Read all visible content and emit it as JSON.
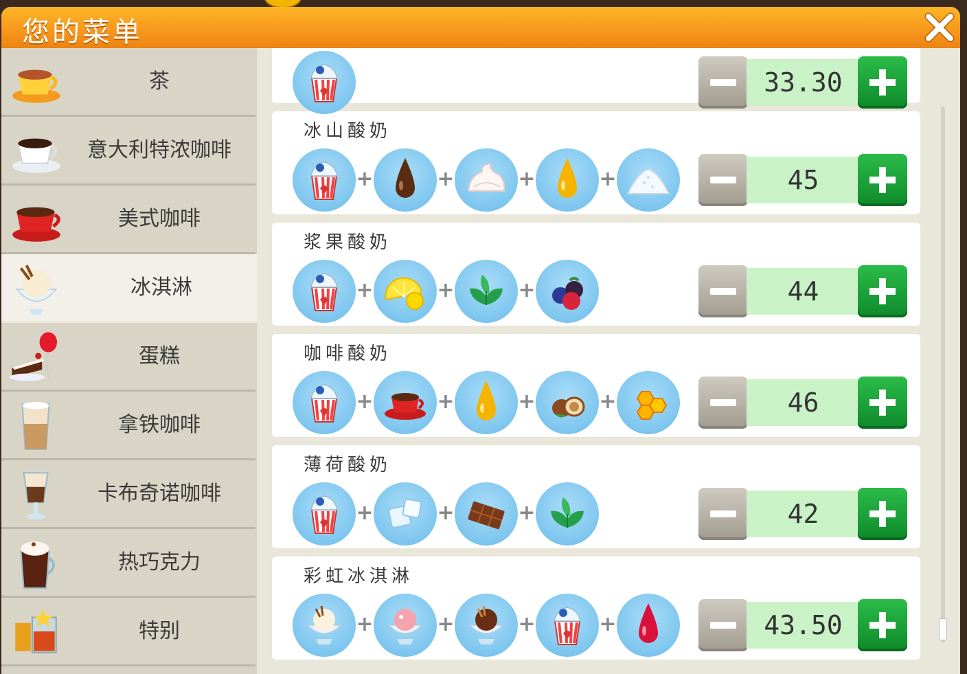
{
  "window": {
    "title": "您的菜单",
    "close_icon": "close-icon"
  },
  "categories": [
    {
      "label": "茶",
      "icon": "tea-cup-icon",
      "active": false
    },
    {
      "label": "意大利特浓咖啡",
      "icon": "espresso-cup-icon",
      "active": false
    },
    {
      "label": "美式咖啡",
      "icon": "americano-cup-icon",
      "active": false
    },
    {
      "label": "冰淇淋",
      "icon": "ice-cream-sundae-icon",
      "active": true
    },
    {
      "label": "蛋糕",
      "icon": "cake-balloon-icon",
      "active": false
    },
    {
      "label": "拿铁咖啡",
      "icon": "latte-glass-icon",
      "active": false
    },
    {
      "label": "卡布奇诺咖啡",
      "icon": "cappuccino-glass-icon",
      "active": false
    },
    {
      "label": "热巧克力",
      "icon": "hot-chocolate-icon",
      "active": false
    },
    {
      "label": "特别",
      "icon": "special-drink-icon",
      "active": false
    }
  ],
  "recipes": [
    {
      "name": "",
      "price": "33.30",
      "ingredients": [
        "yogurt-cup"
      ]
    },
    {
      "name": "冰山酸奶",
      "price": "45",
      "ingredients": [
        "yogurt-cup",
        "chocolate-drop",
        "whipped-cream",
        "syrup-drop",
        "sugar-pile"
      ]
    },
    {
      "name": "浆果酸奶",
      "price": "44",
      "ingredients": [
        "yogurt-cup",
        "lemon",
        "mint",
        "berries"
      ]
    },
    {
      "name": "咖啡酸奶",
      "price": "46",
      "ingredients": [
        "yogurt-cup",
        "coffee-cup",
        "syrup-drop",
        "hazelnut",
        "honeycomb"
      ]
    },
    {
      "name": "薄荷酸奶",
      "price": "42",
      "ingredients": [
        "yogurt-cup",
        "ice-cubes",
        "chocolate-bar",
        "mint"
      ]
    },
    {
      "name": "彩虹冰淇淋",
      "price": "43.50",
      "ingredients": [
        "vanilla-sundae",
        "strawberry-sundae",
        "chocolate-sundae",
        "yogurt-cup",
        "red-drop"
      ]
    }
  ],
  "plus_symbol": "+",
  "colors": {
    "title_bar": "#f7961d",
    "plus_button": "#14a235",
    "minus_button": "#b9b3a8",
    "price_bg": "#c9f3c7",
    "ingredient_bg": "#7ec6ef"
  }
}
